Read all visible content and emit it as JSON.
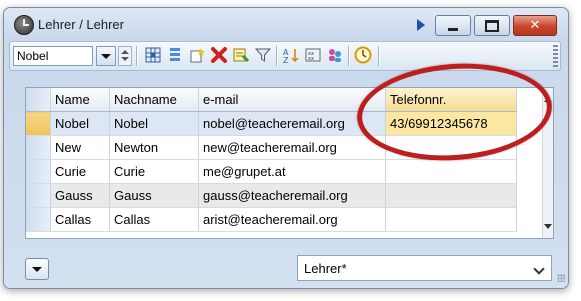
{
  "window": {
    "title": "Lehrer / Lehrer",
    "buttons": {
      "minimize": "minimize",
      "maximize": "maximize",
      "close": "✕"
    }
  },
  "toolbar": {
    "element_selector_value": "Nobel",
    "icons": [
      "grid-settings-icon",
      "list-icon",
      "new-record-icon",
      "delete-icon",
      "report-icon",
      "filter-icon",
      "sort-icon",
      "keypad-icon",
      "people-icon",
      "clock-icon"
    ]
  },
  "table": {
    "columns": [
      "Name",
      "Nachname",
      "e-mail",
      "Telefonnr."
    ],
    "rows": [
      {
        "name": "Nobel",
        "nachname": "Nobel",
        "email": "nobel@teacheremail.org",
        "telefon": "43/69912345678"
      },
      {
        "name": "New",
        "nachname": "Newton",
        "email": "new@teacheremail.org",
        "telefon": ""
      },
      {
        "name": "Curie",
        "nachname": "Curie",
        "email": "me@grupet.at",
        "telefon": ""
      },
      {
        "name": "Gauss",
        "nachname": "Gauss",
        "email": "gauss@teacheremail.org",
        "telefon": ""
      },
      {
        "name": "Callas",
        "nachname": "Callas",
        "email": "arist@teacheremail.org",
        "telefon": ""
      }
    ],
    "selected_row": 0
  },
  "footer": {
    "view_name": "Lehrer*"
  },
  "colors": {
    "selected_row": "#dde7f4",
    "highlight_cell": "#fbe6a2",
    "callout_ring": "#bb1f1f"
  }
}
